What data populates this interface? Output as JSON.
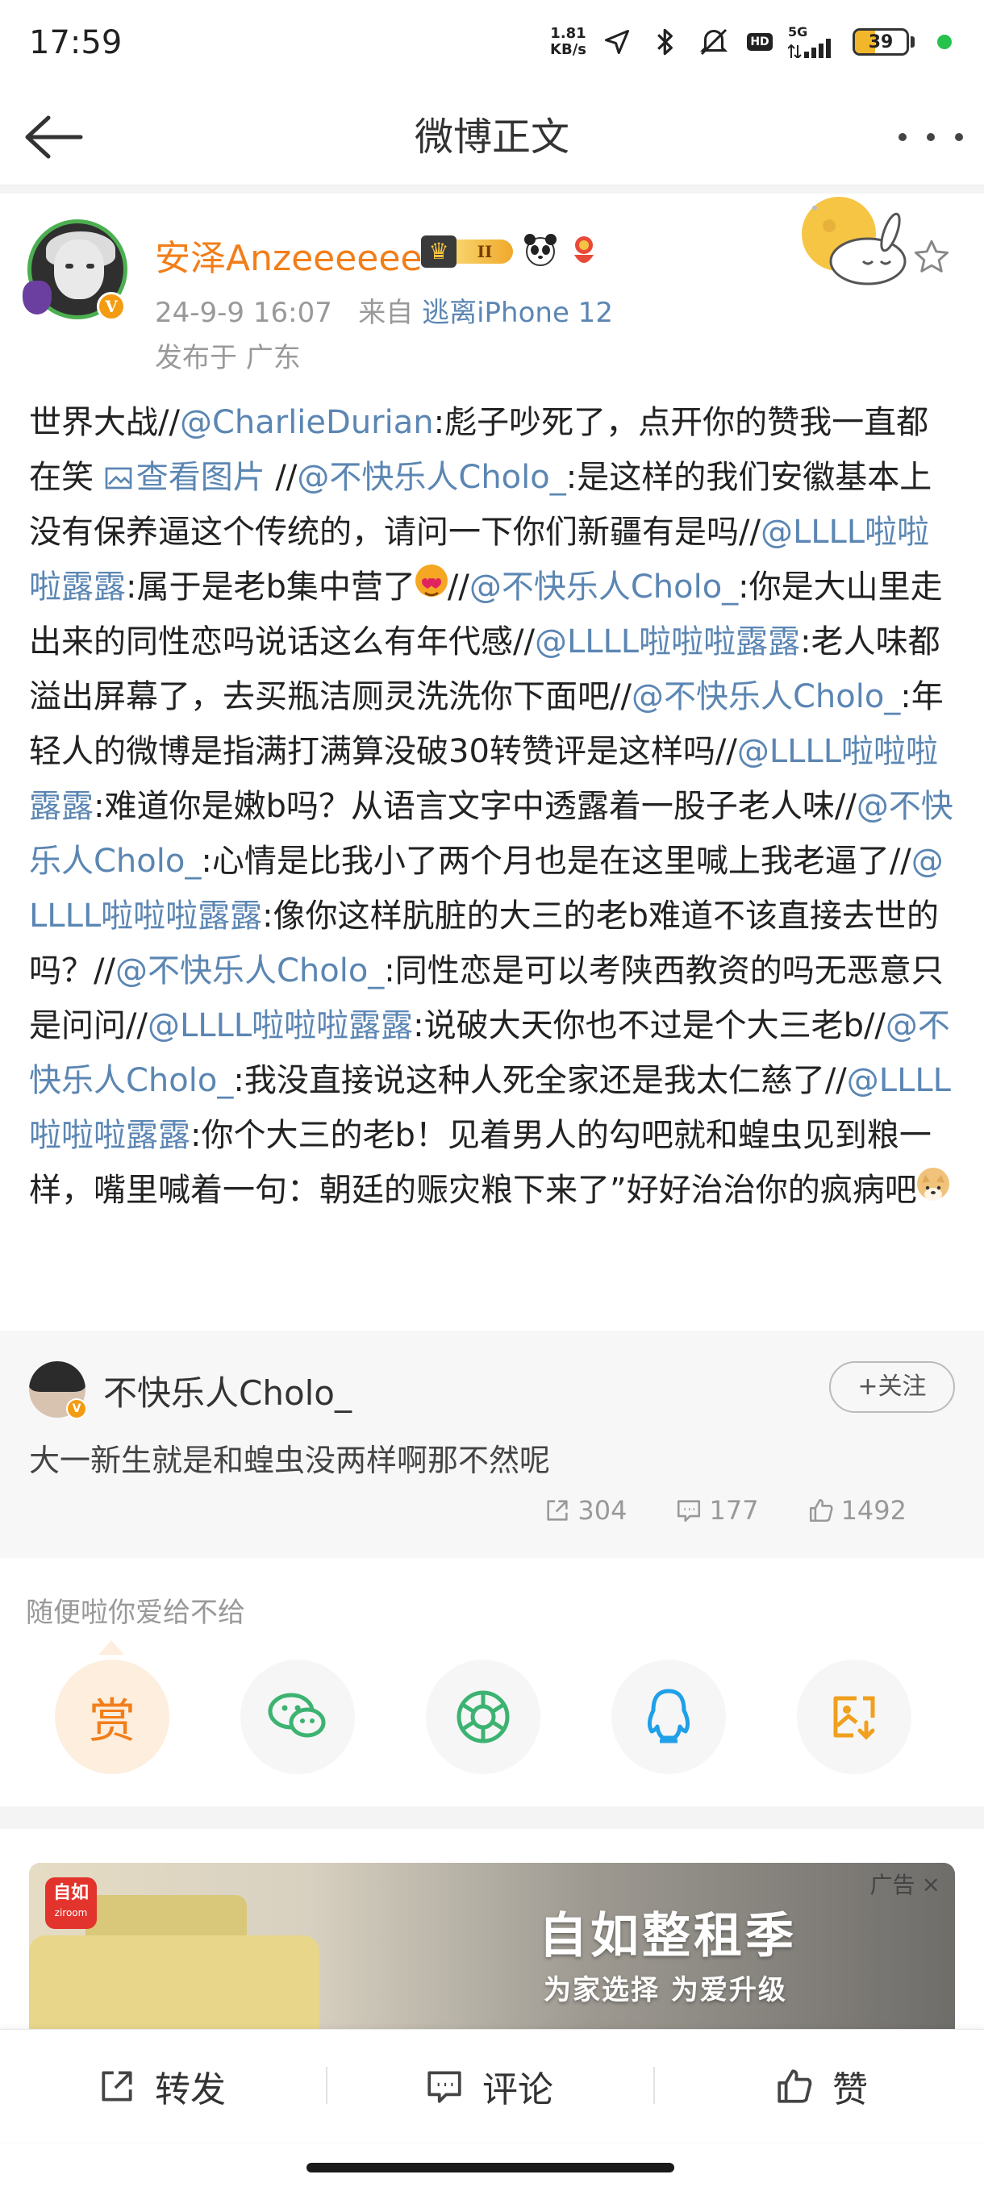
{
  "status_bar": {
    "time": "17:59",
    "net_speed_value": "1.81",
    "net_speed_unit": "KB/s",
    "hd_label": "HD",
    "network": "5G",
    "battery": "39",
    "battery_level": 0.39,
    "icons": [
      "location-icon",
      "bluetooth-icon",
      "mute-icon",
      "signal-icon",
      "battery-icon"
    ]
  },
  "nav": {
    "title": "微博正文",
    "back_icon": "arrow-left-icon",
    "more_icon": "more-dots-icon"
  },
  "post": {
    "author": "安泽Anzeeeeee",
    "vip_level": "II",
    "verified_mark": "V",
    "date": "24-9-9 16:07",
    "source_prefix": "来自",
    "source": "逃离iPhone 12",
    "location": "发布于 广东",
    "body": [
      {
        "t": "text",
        "v": "世界大战//"
      },
      {
        "t": "mention",
        "v": "@CharlieDurian"
      },
      {
        "t": "text",
        "v": ":彪子吵死了，点开你的赞我一直都在笑 "
      },
      {
        "t": "link",
        "v": "查看图片"
      },
      {
        "t": "text",
        "v": "  //"
      },
      {
        "t": "mention",
        "v": "@不快乐人Cholo_"
      },
      {
        "t": "text",
        "v": ":是这样的我们安徽基本上没有保养逼这个传统的，请问一下你们新疆有是吗//"
      },
      {
        "t": "mention",
        "v": "@LLLL啦啦啦露露"
      },
      {
        "t": "text",
        "v": ":属于是老b集中营了"
      },
      {
        "t": "emoji",
        "v": "heart-eyes-emoji"
      },
      {
        "t": "text",
        "v": "//"
      },
      {
        "t": "mention",
        "v": "@不快乐人Cholo_"
      },
      {
        "t": "text",
        "v": ":你是大山里走出来的同性恋吗说话这么有年代感//"
      },
      {
        "t": "mention",
        "v": "@LLLL啦啦啦露露"
      },
      {
        "t": "text",
        "v": ":老人味都溢出屏幕了，去买瓶洁厕灵洗洗你下面吧//"
      },
      {
        "t": "mention",
        "v": "@不快乐人Cholo_"
      },
      {
        "t": "text",
        "v": ":年轻人的微博是指满打满算没破30转赞评是这样吗//"
      },
      {
        "t": "mention",
        "v": "@LLLL啦啦啦露露"
      },
      {
        "t": "text",
        "v": ":难道你是嫩b吗？从语言文字中透露着一股子老人味//"
      },
      {
        "t": "mention",
        "v": "@不快乐人Cholo_"
      },
      {
        "t": "text",
        "v": ":心情是比我小了两个月也是在这里喊上我老逼了//"
      },
      {
        "t": "mention",
        "v": "@LLLL啦啦啦露露"
      },
      {
        "t": "text",
        "v": ":像你这样肮脏的大三的老b难道不该直接去世的吗？//"
      },
      {
        "t": "mention",
        "v": "@不快乐人Cholo_"
      },
      {
        "t": "text",
        "v": ":同性恋是可以考陕西教资的吗无恶意只是问问//"
      },
      {
        "t": "mention",
        "v": "@LLLL啦啦啦露露"
      },
      {
        "t": "text",
        "v": ":说破大天你也不过是个大三老b//"
      },
      {
        "t": "mention",
        "v": "@不快乐人Cholo_"
      },
      {
        "t": "text",
        "v": ":我没直接说这种人死全家还是我太仁慈了//"
      },
      {
        "t": "mention",
        "v": "@LLLL啦啦啦露露"
      },
      {
        "t": "text",
        "v": ":你个大三的老b！见着男人的勾吧就和蝗虫见到粮一样，嘴里喊着一句：朝廷的赈灾粮下来了”好好治治你的疯病吧"
      },
      {
        "t": "emoji",
        "v": "doge-emoji"
      }
    ]
  },
  "comment": {
    "name": "不快乐人Cholo_",
    "follow_label": "+关注",
    "text": "大一新生就是和蝗虫没两样啊那不然呢",
    "reposts": "304",
    "comments": "177",
    "likes": "1492"
  },
  "reward": {
    "prompt": "随便啦你爱给不给",
    "reward_label": "赏",
    "share_targets": [
      "wechat-icon",
      "moments-icon",
      "qq-icon",
      "save-image-icon"
    ]
  },
  "ad": {
    "label": "广告",
    "close": "×",
    "brand": "自如",
    "brand_sub": "ziroom",
    "title": "自如整租季",
    "subtitle": "为家选择 为爱升级"
  },
  "bottom_bar": {
    "repost": "转发",
    "comment": "评论",
    "like": "赞"
  },
  "colors": {
    "author_orange": "#f27e19",
    "link_blue": "#5b86b3",
    "meta_gray": "#999999"
  }
}
